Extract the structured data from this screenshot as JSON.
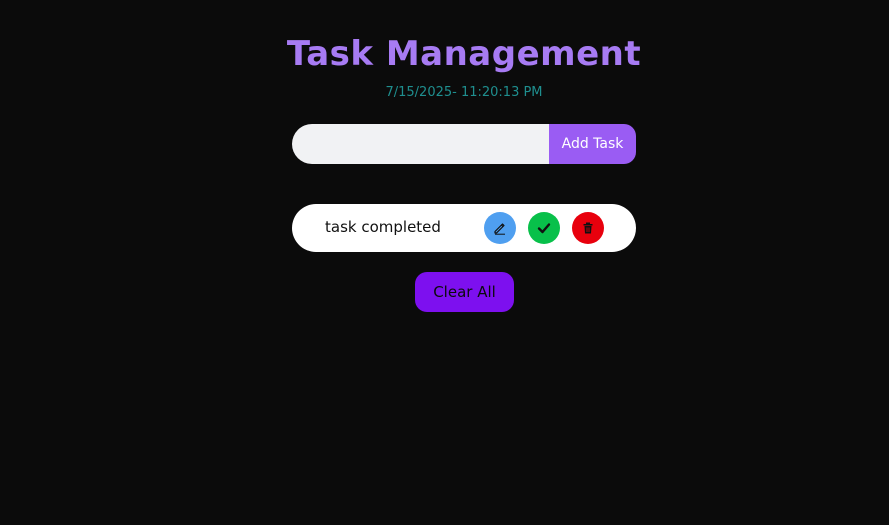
{
  "header": {
    "title": "Task Management",
    "datetime": "7/15/2025- 11:20:13 PM"
  },
  "form": {
    "input_value": "",
    "input_placeholder": "",
    "add_label": "Add Task"
  },
  "tasks": [
    {
      "text": "task completed",
      "actions": [
        "pencil-icon",
        "checkmark-icon",
        "trash-icon"
      ]
    }
  ],
  "footer": {
    "clear_label": "Clear All"
  },
  "colors": {
    "background": "#0b0b0b",
    "title": "#a77bf3",
    "datetime": "#1f8f8f",
    "add_button": "#9a5cf3",
    "edit": "#4f9ff0",
    "complete": "#08c04a",
    "delete": "#e8000d",
    "clear_button": "#7d10ef"
  }
}
